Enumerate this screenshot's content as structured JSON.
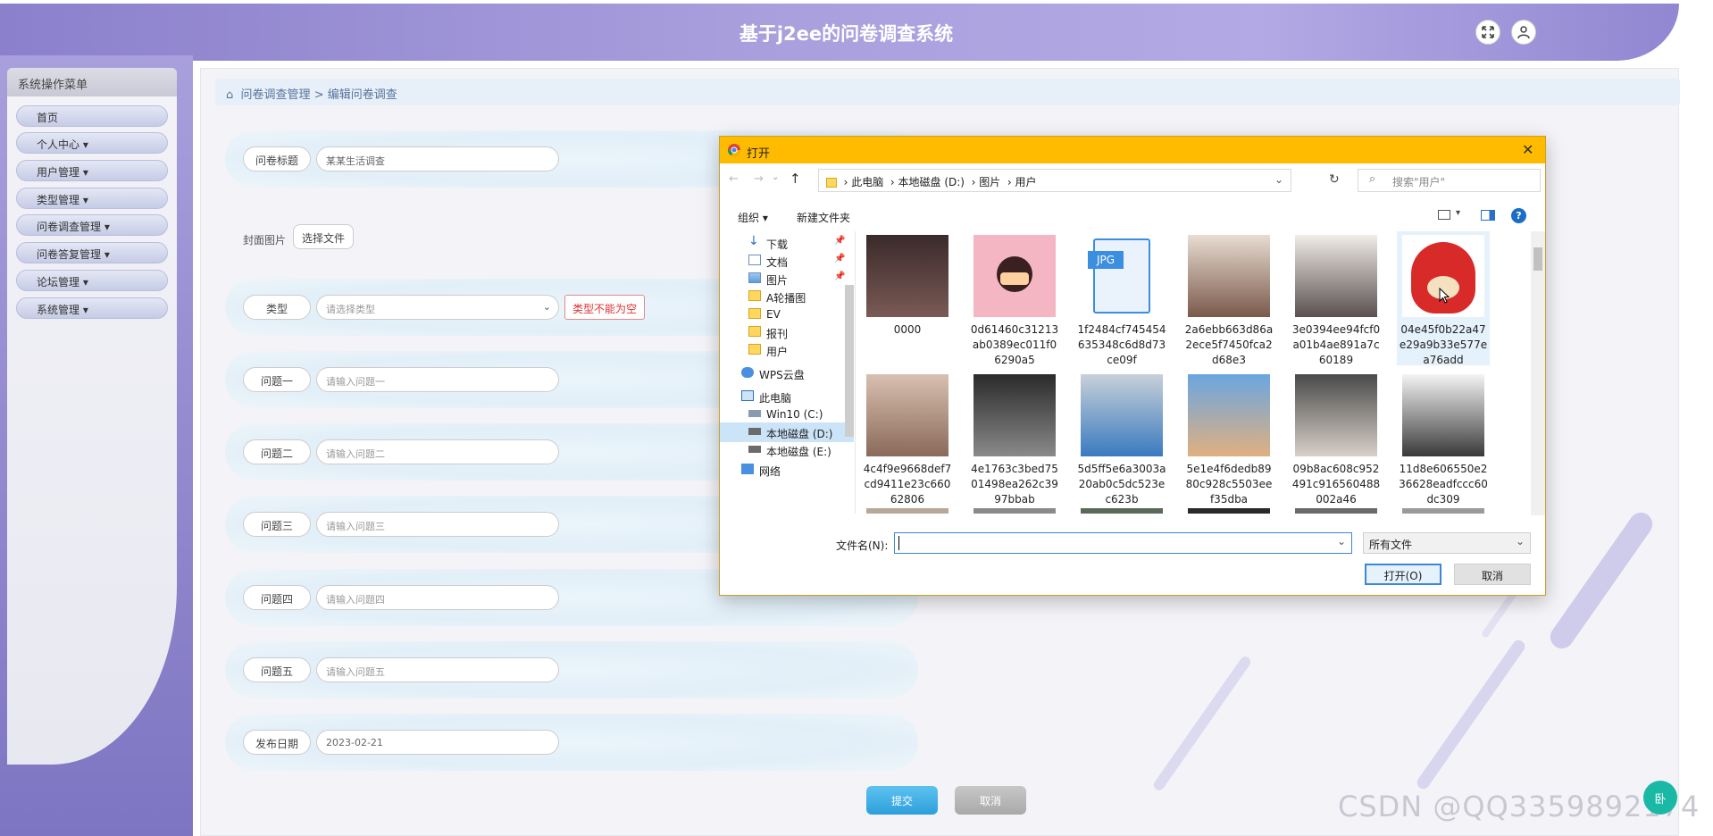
{
  "header": {
    "title": "基于j2ee的问卷调查系统"
  },
  "sidebar": {
    "title": "系统操作菜单",
    "items": [
      {
        "label": "首页"
      },
      {
        "label": "个人中心 ▾"
      },
      {
        "label": "用户管理 ▾"
      },
      {
        "label": "类型管理 ▾"
      },
      {
        "label": "问卷调查管理 ▾"
      },
      {
        "label": "问卷答复管理 ▾"
      },
      {
        "label": "论坛管理 ▾"
      },
      {
        "label": "系统管理 ▾"
      }
    ]
  },
  "breadcrumb": {
    "root": "问卷调查管理",
    "sep": ">",
    "current": "编辑问卷调查"
  },
  "form": {
    "title_label": "问卷标题",
    "title_value": "某某生活调查",
    "cover_label": "封面图片",
    "cover_button": "选择文件",
    "type_label": "类型",
    "type_placeholder": "请选择类型",
    "type_error": "类型不能为空",
    "questions": [
      {
        "label": "问题一",
        "placeholder": "请输入问题一"
      },
      {
        "label": "问题二",
        "placeholder": "请输入问题二"
      },
      {
        "label": "问题三",
        "placeholder": "请输入问题三"
      },
      {
        "label": "问题四",
        "placeholder": "请输入问题四"
      },
      {
        "label": "问题五",
        "placeholder": "请输入问题五"
      }
    ],
    "date_label": "发布日期",
    "date_value": "2023-02-21",
    "submit": "提交",
    "cancel": "取消"
  },
  "dialog": {
    "title": "打开",
    "path": [
      "此电脑",
      "本地磁盘 (D:)",
      "图片",
      "用户"
    ],
    "search_placeholder": "搜索\"用户\"",
    "organize": "组织 ▾",
    "new_folder": "新建文件夹",
    "nav": [
      {
        "label": "下载",
        "icon": "download-icon"
      },
      {
        "label": "文档",
        "icon": "document-icon"
      },
      {
        "label": "图片",
        "icon": "picture-icon"
      },
      {
        "label": "A轮播图",
        "icon": "folder-icon"
      },
      {
        "label": "EV",
        "icon": "folder-icon"
      },
      {
        "label": "报刊",
        "icon": "folder-icon"
      },
      {
        "label": "用户",
        "icon": "folder-icon"
      },
      {
        "label": "WPS云盘",
        "icon": "cloud-icon"
      },
      {
        "label": "此电脑",
        "icon": "computer-icon"
      },
      {
        "label": "Win10 (C:)",
        "icon": "drive-icon"
      },
      {
        "label": "本地磁盘 (D:)",
        "icon": "drive-icon"
      },
      {
        "label": "本地磁盘 (E:)",
        "icon": "drive-icon"
      },
      {
        "label": "网络",
        "icon": "network-icon"
      }
    ],
    "files": [
      {
        "name": "0000",
        "color": "#3a2a2a"
      },
      {
        "name": "0d61460c31213ab0389ec011f06290a5",
        "color": "#f4b6c2"
      },
      {
        "name": "1f2484cf745454635348c6d8d73ce09f",
        "color": "#ffffff"
      },
      {
        "name": "2a6ebb663d86a2ece5f7450fca2d68e3",
        "color": "#c9b7a8"
      },
      {
        "name": "3e0394ee94fcf0a01b4ae891a7c60189",
        "color": "#d8d3cc"
      },
      {
        "name": "04e45f0b22a47e29a9b33e577ea76add",
        "color": "#d92a2a"
      },
      {
        "name": "4c4f9e9668def7cd9411e23c66062806",
        "color": "#b48c78"
      },
      {
        "name": "4e1763c3bed7501498ea262c3997bbab",
        "color": "#5c5c5c"
      },
      {
        "name": "5d5ff5e6a3003a20ab0c5dc523ec623b",
        "color": "#7aa6c9"
      },
      {
        "name": "5e1e4f6dedb8980c928c5503eef35dba",
        "color": "#d9a273"
      },
      {
        "name": "09b8ac608c952491c916560488002a46",
        "color": "#6b6b6b"
      },
      {
        "name": "11d8e606550e236628eadfccc60dc309",
        "color": "#f1f1f1"
      }
    ],
    "filename_label": "文件名(N):",
    "filetype": "所有文件",
    "open_btn": "打开(O)",
    "cancel_btn": "取消"
  },
  "watermark": "CSDN @QQ3359892174",
  "help_fab": "卧"
}
